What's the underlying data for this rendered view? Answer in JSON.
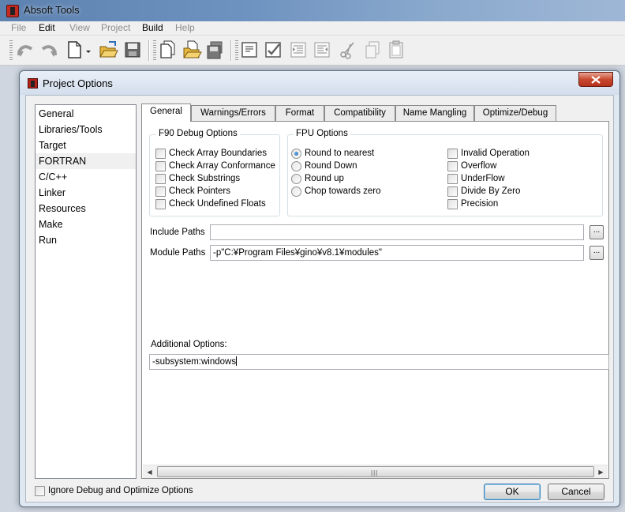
{
  "main_window": {
    "title": "Absoft Tools",
    "menu": [
      "File",
      "Edit",
      "View",
      "Project",
      "Build",
      "Help"
    ],
    "menu_disabled": [
      true,
      false,
      true,
      true,
      false,
      true
    ]
  },
  "toolbar": {
    "icons": [
      "undo-icon",
      "redo-icon",
      "new-file-icon",
      "open-folder-icon",
      "save-icon",
      "new-project-icon",
      "open-project-icon",
      "save-project-icon",
      "comment-icon",
      "edit-check-icon",
      "indent-icon",
      "outdent-icon",
      "cut-icon",
      "copy-icon",
      "paste-icon"
    ]
  },
  "dialog": {
    "title": "Project Options",
    "categories": [
      "General",
      "Libraries/Tools",
      "Target",
      "FORTRAN",
      "C/C++",
      "Linker",
      "Resources",
      "Make",
      "Run"
    ],
    "selected_category": "FORTRAN",
    "tabs": [
      "General",
      "Warnings/Errors",
      "Format",
      "Compatibility",
      "Name Mangling",
      "Optimize/Debug"
    ],
    "active_tab": "General",
    "f90_debug": {
      "title": "F90 Debug Options",
      "options": [
        {
          "label": "Check Array Boundaries",
          "checked": false
        },
        {
          "label": "Check Array Conformance",
          "checked": false
        },
        {
          "label": "Check Substrings",
          "checked": false
        },
        {
          "label": "Check Pointers",
          "checked": false
        },
        {
          "label": "Check Undefined Floats",
          "checked": false
        }
      ]
    },
    "fpu": {
      "title": "FPU Options",
      "rounding": [
        {
          "label": "Round to nearest",
          "checked": true
        },
        {
          "label": "Round Down",
          "checked": false
        },
        {
          "label": "Round up",
          "checked": false
        },
        {
          "label": "Chop towards zero",
          "checked": false
        }
      ],
      "exceptions": [
        {
          "label": "Invalid Operation",
          "checked": false
        },
        {
          "label": "Overflow",
          "checked": false
        },
        {
          "label": "UnderFlow",
          "checked": false
        },
        {
          "label": "Divide By Zero",
          "checked": false
        },
        {
          "label": "Precision",
          "checked": false
        }
      ]
    },
    "include_paths": {
      "label": "Include Paths",
      "value": ""
    },
    "module_paths": {
      "label": "Module Paths",
      "value": "-p\"C:¥Program Files¥gino¥v8.1¥modules\""
    },
    "additional_options": {
      "label": "Additional Options:",
      "value": "-subsystem:windows"
    },
    "browse_label": "...",
    "ignore_debug": {
      "label": "Ignore Debug and Optimize Options",
      "checked": false
    },
    "ok_label": "OK",
    "cancel_label": "Cancel"
  }
}
